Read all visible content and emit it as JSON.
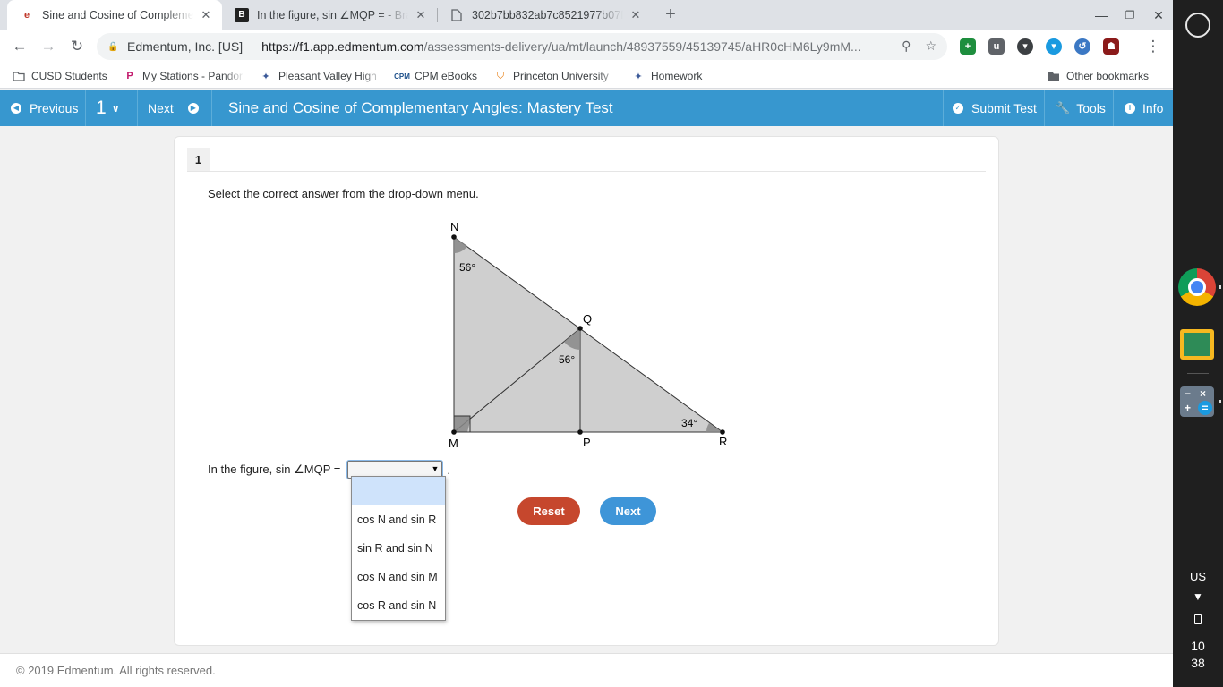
{
  "browser": {
    "tabs": [
      {
        "title": "Sine and Cosine of Complement",
        "favicon": "edmentum-icon"
      },
      {
        "title": "In the figure, sin ∠MQP = - Brain",
        "favicon": "brainly-icon"
      },
      {
        "title": "302b7bb832ab7c8521977b07f",
        "favicon": "document-icon"
      }
    ],
    "new_tab": "+",
    "omnibox": {
      "site_label": "Edmentum, Inc. [US]",
      "url_host": "https://f1.app.edmentum.com",
      "url_path": "/assessments-delivery/ua/mt/launch/48937559/45139745/aHR0cHM6Ly9mM..."
    },
    "bookmarks": [
      "CUSD Students",
      "My Stations - Pandor",
      "Pleasant Valley High",
      "CPM eBooks",
      "Princeton University",
      "Homework"
    ],
    "other_bookmarks": "Other bookmarks"
  },
  "appbar": {
    "previous": "Previous",
    "question_number": "1",
    "next": "Next",
    "title": "Sine and Cosine of Complementary Angles: Mastery Test",
    "submit": "Submit Test",
    "tools": "Tools",
    "info": "Info",
    "color": "#3797cf"
  },
  "question": {
    "number": "1",
    "instruction": "Select the correct answer from the drop-down menu.",
    "prompt": "In the figure, sin ∠MQP =",
    "after_select": ".",
    "selected_value": "",
    "options": [
      "",
      "cos N and sin R",
      "sin R and sin N",
      "cos N and sin M",
      "cos R and sin N"
    ]
  },
  "figure": {
    "vertices": {
      "N": "N",
      "Q": "Q",
      "M": "M",
      "P": "P",
      "R": "R"
    },
    "angle_N": "56°",
    "angle_Q": "56°",
    "angle_R": "34°"
  },
  "buttons": {
    "reset": "Reset",
    "next": "Next",
    "reset_color": "#c6472d",
    "next_color": "#3e95d8"
  },
  "footer": {
    "copyright": "© 2019 Edmentum. All rights reserved."
  },
  "shelf": {
    "language": "US",
    "time_hour": "10",
    "time_minute": "38"
  }
}
